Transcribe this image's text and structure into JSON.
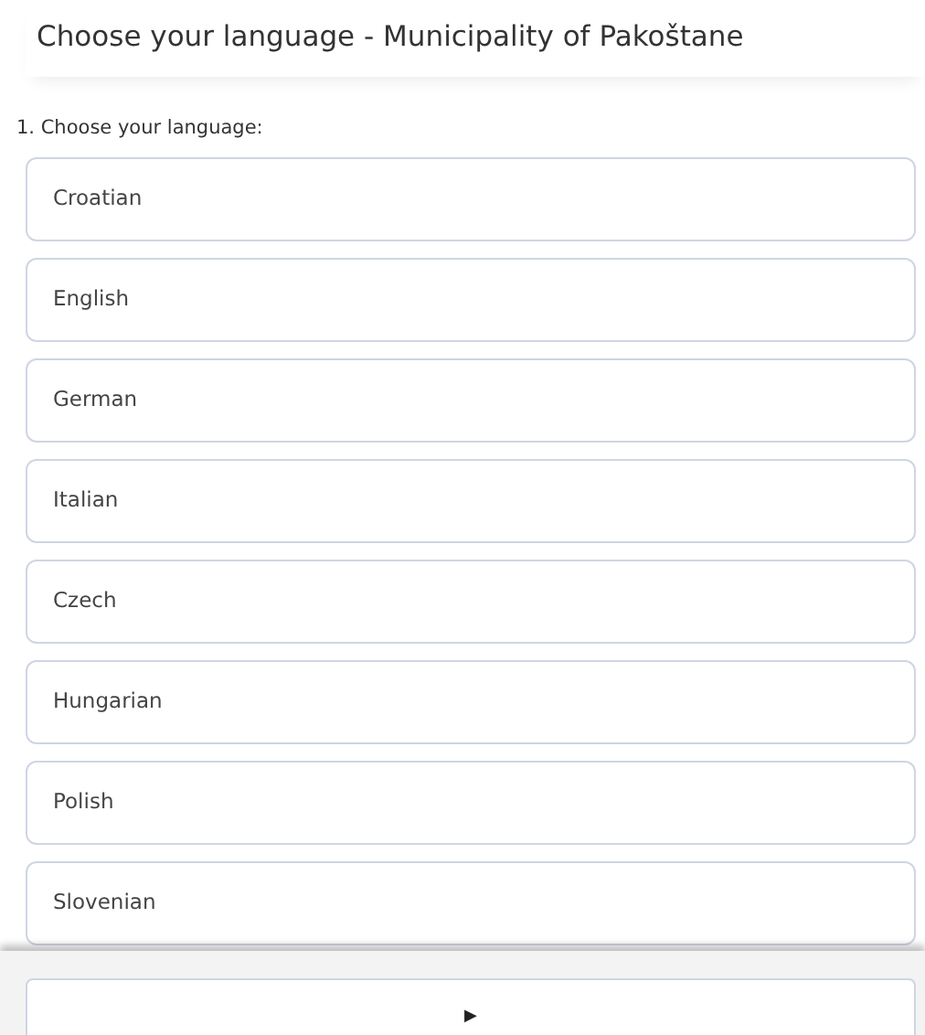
{
  "header": {
    "title": "Choose your language - Municipality of Pakoštane"
  },
  "question": {
    "label": "1. Choose your language:",
    "options": [
      {
        "label": "Croatian",
        "selected": false
      },
      {
        "label": "English",
        "selected": false
      },
      {
        "label": "German",
        "selected": false
      },
      {
        "label": "Italian",
        "selected": false
      },
      {
        "label": "Czech",
        "selected": false
      },
      {
        "label": "Hungarian",
        "selected": false
      },
      {
        "label": "Polish",
        "selected": false
      },
      {
        "label": "Slovenian",
        "selected": false
      }
    ]
  },
  "footer": {
    "next_button": "▶"
  }
}
